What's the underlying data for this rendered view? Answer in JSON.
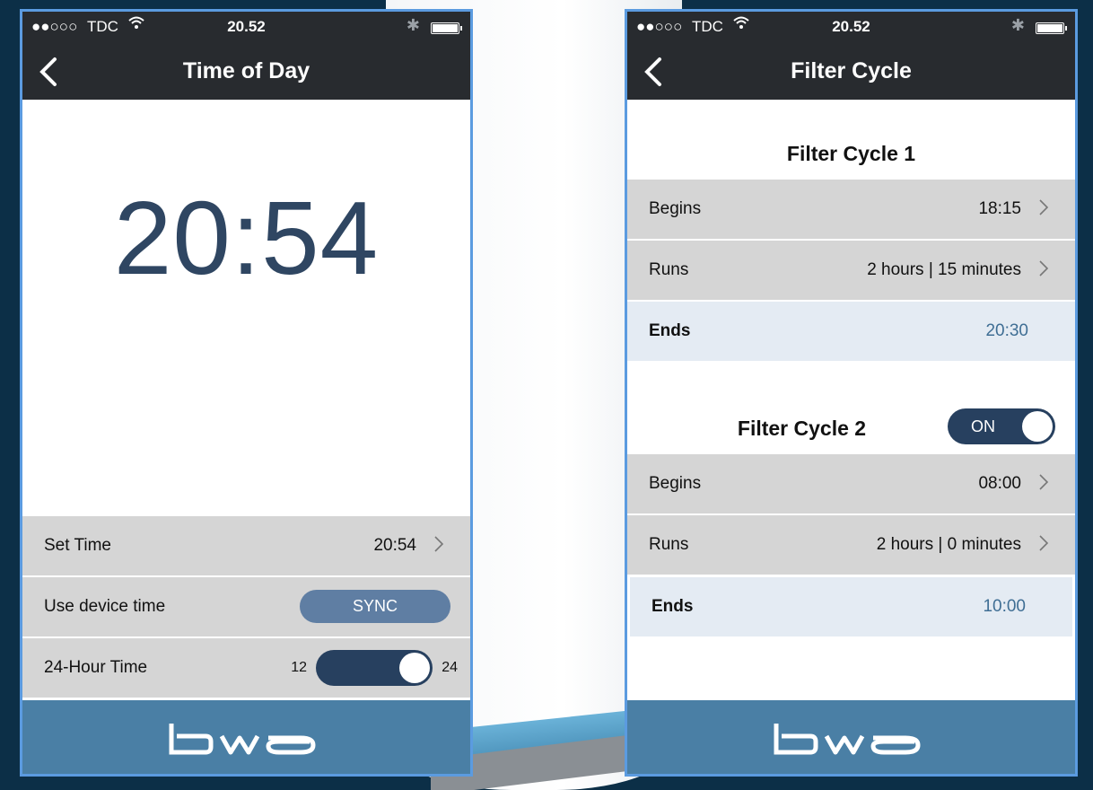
{
  "status": {
    "signal": "●●○○○",
    "carrier": "TDC",
    "clock": "20.52"
  },
  "left": {
    "title": "Time of Day",
    "big_time": "20:54",
    "rows": {
      "set_time": {
        "label": "Set Time",
        "value": "20:54"
      },
      "device_time": {
        "label": "Use device time",
        "button": "SYNC"
      },
      "hour24": {
        "label": "24-Hour Time",
        "left": "12",
        "right": "24",
        "selected": "24"
      }
    },
    "logo": "bwa"
  },
  "right": {
    "title": "Filter Cycle",
    "cycle1": {
      "title": "Filter Cycle 1",
      "begins_label": "Begins",
      "begins": "18:15",
      "runs_label": "Runs",
      "runs": "2 hours | 15 minutes",
      "ends_label": "Ends",
      "ends": "20:30"
    },
    "cycle2": {
      "title": "Filter Cycle 2",
      "toggle": "ON",
      "begins_label": "Begins",
      "begins": "08:00",
      "runs_label": "Runs",
      "runs": "2 hours | 0 minutes",
      "ends_label": "Ends",
      "ends": "10:00"
    },
    "logo": "bwa"
  },
  "colors": {
    "background": "#0c2f47",
    "nav": "#282b2f",
    "accent": "#27405f",
    "footer": "#4a7fa5",
    "ends_value": "#3f6e94"
  }
}
